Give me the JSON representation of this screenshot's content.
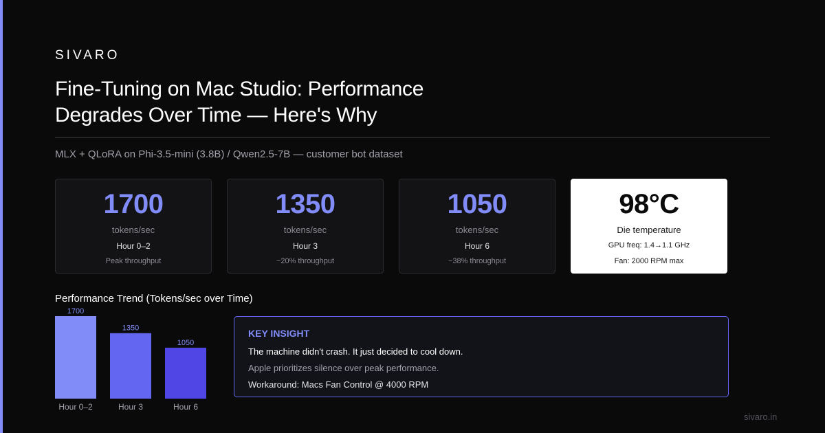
{
  "brand": "SIVARO",
  "title": "Fine-Tuning on Mac Studio: Performance Degrades Over Time — Here's Why",
  "subtitle": "MLX + QLoRA on Phi-3.5-mini (3.8B) / Qwen2.5-7B — customer bot dataset",
  "colors": {
    "accent": "#818cf8",
    "accent_mid": "#6366f1",
    "accent_dark": "#4f46e5",
    "background": "#0a0a0b"
  },
  "cards": [
    {
      "value": "1700",
      "unit": "tokens/sec",
      "period": "Hour 0–2",
      "note": "Peak throughput"
    },
    {
      "value": "1350",
      "unit": "tokens/sec",
      "period": "Hour 3",
      "note": "−20% throughput"
    },
    {
      "value": "1050",
      "unit": "tokens/sec",
      "period": "Hour 6",
      "note": "−38% throughput"
    },
    {
      "value": "98°C",
      "unit": "Die temperature",
      "period": "GPU freq: 1.4→1.1 GHz",
      "note": "Fan: 2000 RPM max"
    }
  ],
  "chart_data": {
    "type": "bar",
    "title": "Performance Trend (Tokens/sec over Time)",
    "categories": [
      "Hour 0–2",
      "Hour 3",
      "Hour 6"
    ],
    "values": [
      1700,
      1350,
      1050
    ],
    "colors": [
      "#818cf8",
      "#6366f1",
      "#4f46e5"
    ],
    "grid": false
  },
  "insight": {
    "heading": "KEY INSIGHT",
    "line1": "The machine didn't crash. It just decided to cool down.",
    "line2": "Apple prioritizes silence over peak performance.",
    "line3": "Workaround: Macs Fan Control @ 4000 RPM"
  },
  "footer": "sivaro.in"
}
